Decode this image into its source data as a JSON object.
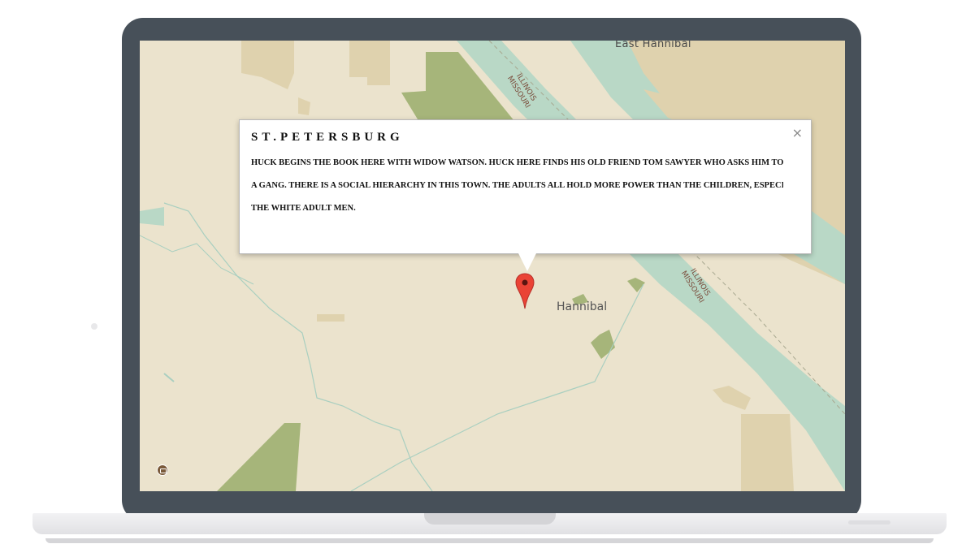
{
  "map": {
    "places": {
      "east_hannibal": "East Hannibal",
      "hannibal": "Hannibal"
    },
    "river_labels": [
      {
        "line1": "ILLINOIS",
        "line2": "MISSOURI"
      },
      {
        "line1": "ILLINOIS",
        "line2": "MISSOURI"
      }
    ],
    "colors": {
      "land": "#ebe3cd",
      "river": "#b9d8c6",
      "park": "#a6b57a",
      "urban": "#dfd2ae"
    },
    "marker_icon": "map-pin-icon",
    "poi_icon": "museum-icon"
  },
  "popup": {
    "title": "ST.PETERSBURG",
    "close_label": "×",
    "body_lines": [
      "HUCK BEGINS THE BOOK HERE WITH WIDOW WATSON. HUCK HERE FINDS HIS OLD FRIEND TOM SAWYER WHO ASKS HIM TO JOIN",
      "A GANG. THERE IS A SOCIAL HIERARCHY IN THIS TOWN. THE ADULTS ALL HOLD MORE POWER THAN THE CHILDREN, ESPECIALLY",
      "THE WHITE ADULT MEN."
    ]
  }
}
